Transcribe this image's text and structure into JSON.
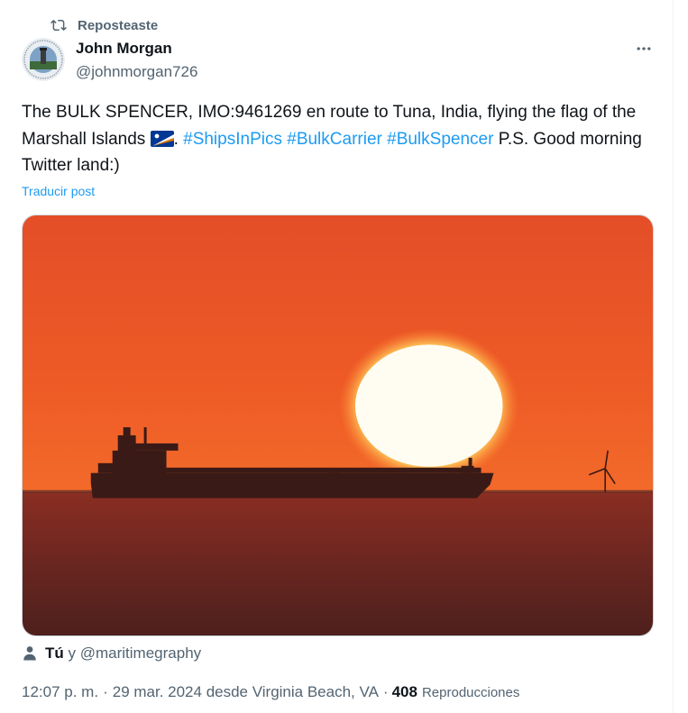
{
  "repost": {
    "label": "Reposteaste",
    "icon": "repost-icon"
  },
  "author": {
    "name": "John Morgan",
    "handle": "@johnmorgan726",
    "avatar_icon": "seal-avatar"
  },
  "tweet": {
    "text_part1": "The BULK SPENCER, IMO:9461269 en route to Tuna, India, flying the flag of the Marshall Islands ",
    "flag_icon": "marshall-islands-flag",
    "text_part2": ". ",
    "hashtags": [
      "#ShipsInPics",
      "#BulkCarrier",
      "#BulkSpencer"
    ],
    "text_part3": " P.S. Good morning Twitter land:)"
  },
  "translate_label": "Traducir post",
  "tagged": {
    "you": "Tú",
    "joiner": "y",
    "other": "@maritimegraphy"
  },
  "meta": {
    "time": "12:07 p. m.",
    "date": "29 mar. 2024 desde Virginia Beach, VA",
    "separator": "·",
    "views": "408",
    "views_label": "Reproducciones"
  },
  "colors": {
    "link": "#1d9bf0",
    "secondary": "#536471",
    "sky": "#e8532a"
  }
}
